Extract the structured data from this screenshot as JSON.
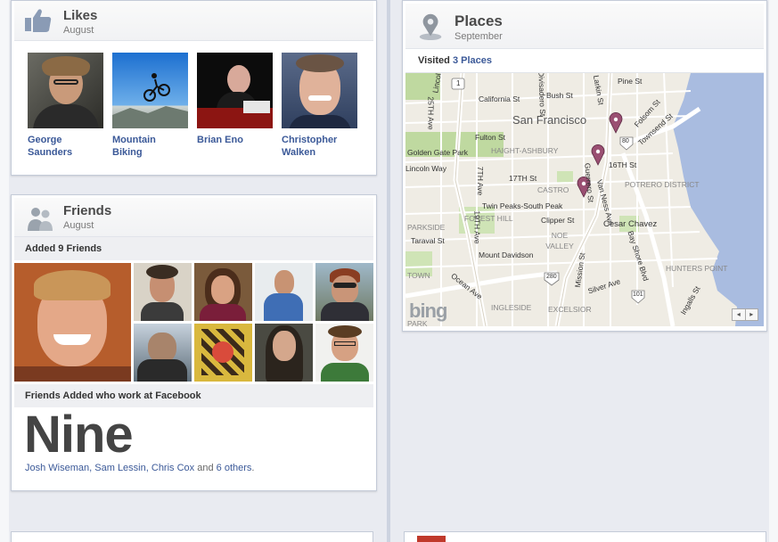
{
  "likes": {
    "title": "Likes",
    "subtitle": "August",
    "items": [
      {
        "name_line1": "George",
        "name_line2": "Saunders"
      },
      {
        "name_line1": "Mountain",
        "name_line2": "Biking"
      },
      {
        "name_line1": "Brian Eno",
        "name_line2": ""
      },
      {
        "name_line1": "Christopher",
        "name_line2": "Walken"
      }
    ]
  },
  "friends": {
    "title": "Friends",
    "subtitle": "August",
    "added_label": "Added 9 Friends",
    "work_label": "Friends Added who work at Facebook",
    "big_number": "Nine",
    "names": [
      "Josh Wiseman",
      "Sam Lessin",
      "Chris Cox"
    ],
    "and_text": "and",
    "others_link": "6 others",
    "period": "."
  },
  "places": {
    "title": "Places",
    "subtitle": "September",
    "visited_prefix": "Visited",
    "visited_link": "3 Places",
    "map_labels": {
      "san_francisco": "San Francisco",
      "california_st": "California St",
      "bush_st": "Bush St",
      "pine_st": "Pine St",
      "fulton_st": "Fulton St",
      "folsom_st": "Folsom St",
      "townsend_st": "Townsend St",
      "golden_gate_park": "Golden Gate Park",
      "haight_ashbury": "HAIGHT-ASHBURY",
      "sixteenth_st": "16TH St",
      "lincoln_way": "Lincoln Way",
      "seventeenth_st": "17TH St",
      "castro": "CASTRO",
      "potrero_district": "POTRERO DISTRICT",
      "twin_peaks": "Twin Peaks-South Peak",
      "forest_hill": "FOREST HILL",
      "clipper_st": "Clipper St",
      "cesar_chavez": "Cesar Chavez",
      "parkside": "PARKSIDE",
      "taraval_st": "Taraval St",
      "noe_valley": "NOE VALLEY",
      "mount_davidson": "Mount Davidson",
      "hunters_point": "HUNTERS POINT",
      "ocean_ave": "Ocean Ave",
      "silver_ave": "Silver Ave",
      "ingleside": "INGLESIDE",
      "excelsior": "EXCELSIOR",
      "ingalls_st": "Ingalls St",
      "twenty_fifth_ave": "25TH Ave",
      "seventh_ave": "7TH Ave",
      "nineteenth_ave": "19TH Ave",
      "van_ness": "Van Ness Ave",
      "mission_st": "Mission St",
      "guerrero_st": "Guerrero St",
      "bay_shore": "Bay Shore Blvd",
      "larkin_st": "Larkin St",
      "divisadero": "Divisadero St",
      "lincoln_top": "Lincoln",
      "park": "PARK",
      "town": "TOWN",
      "hwy_1": "1",
      "hwy_80": "80",
      "hwy_101": "101",
      "hwy_280": "280",
      "bing": "bing"
    },
    "nav_prev": "◂",
    "nav_next": "▸"
  },
  "colors": {
    "link": "#3b5998",
    "map_water": "#a9bce0",
    "map_park": "#bfd9a0",
    "pin": "#9a4f72"
  }
}
